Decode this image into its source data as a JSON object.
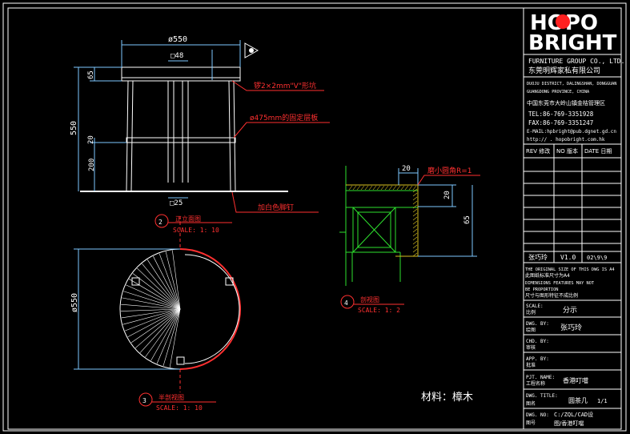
{
  "colors": {
    "background": "#000000",
    "frame": "#ffffff",
    "dimension": "#7ec8ff",
    "annotation": "#ff3030",
    "detail": "#2ee02e",
    "hatch": "#d8c020",
    "brand_red": "#ff2020",
    "yellow": "#ffff40"
  },
  "logo": {
    "text_top": "HOPO",
    "text_bottom": "BRIGHT"
  },
  "company": {
    "name_en": "FURNITURE GROUP CO., LTD.",
    "name_cn": "东莞明辉家私有限公司",
    "addr1": "DUOJU DISTRICT, DALINGSHAN, DONGGUAN",
    "addr2": "GUANGDONG PROVINCE, CHINA",
    "addr_cn": "中国东莞市大岭山镇金桔管理区",
    "tel": "TEL:86-769-3351928",
    "fax": "FAX:86-769-3351247",
    "email": "E-MAIL:hpbright@pub.dgnet.gd.cn",
    "web": "http:// . hopobright.com.hk"
  },
  "revision": {
    "headers": [
      "REV 修改",
      "NO 版本",
      "DATE 日期"
    ],
    "row": [
      "张巧玲",
      "V1.0",
      "02\\9\\9"
    ]
  },
  "notes": {
    "en1": "THE ORIGINAL SIZE OF THIS DWG IS A4",
    "cn1": "此图纸标准尺寸为A4",
    "en2": "DIMENSIONS FEATURES MAY NOT",
    "en3": "BE PROPORTION",
    "cn2": "尺寸与图形特征不成比例"
  },
  "title_block": [
    {
      "label_en": "SCALE:",
      "label_cn": "比例",
      "value": "分示"
    },
    {
      "label_en": "DWG. BY:",
      "label_cn": "绘图",
      "value": "张巧玲"
    },
    {
      "label_en": "CHD. BY:",
      "label_cn": "审核",
      "value": ""
    },
    {
      "label_en": "APP. BY:",
      "label_cn": "批准",
      "value": ""
    },
    {
      "label_en": "PJT. NAME:",
      "label_cn": "工程名称",
      "value": "香港叮噹"
    },
    {
      "label_en": "DWG. TITLE:",
      "label_cn": "图名",
      "value": "圆茶几",
      "extra": "1/1"
    },
    {
      "label_en": "DWG. NO:",
      "label_cn": "图号",
      "value": "C:/ZQL/CAD设",
      "value2": "图/香港叮噹"
    }
  ],
  "material": "材料：樟木",
  "front_view": {
    "top_dim": "ø550",
    "inner_dim": "□48",
    "height_dim": "550",
    "dim_65": "65",
    "dim_20": "20",
    "dim_200": "200",
    "foot_dim": "□25",
    "note_groove": "锣2×2mm\"V\"形坑",
    "note_shelf": "ø475mm的固定层板",
    "note_foot": "加白色脚钉",
    "title": "正立面图",
    "scale": "SCALE: 1: 10",
    "marker_num": "2"
  },
  "plan_view": {
    "diameter_dim": "ø550",
    "title": "半剖视图",
    "scale": "SCALE: 1: 10",
    "marker_num": "3"
  },
  "section_view": {
    "dim_top": "20",
    "dim_side": "20",
    "dim_total": "65",
    "note_edge": "磨小圆角R=1",
    "title": "剖视图",
    "scale": "SCALE: 1: 2",
    "marker_num": "4"
  }
}
